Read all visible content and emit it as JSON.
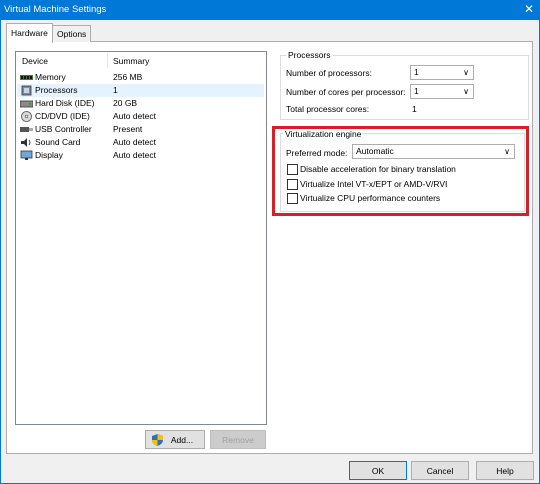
{
  "window": {
    "title": "Virtual Machine Settings",
    "close_glyph": "✕"
  },
  "tabs": [
    {
      "label": "Hardware"
    },
    {
      "label": "Options"
    }
  ],
  "device_list": {
    "col_device": "Device",
    "col_summary": "Summary",
    "rows": [
      {
        "device": "Memory",
        "summary": "256 MB",
        "icon": "memory-icon"
      },
      {
        "device": "Processors",
        "summary": "1",
        "icon": "processor-icon"
      },
      {
        "device": "Hard Disk (IDE)",
        "summary": "20 GB",
        "icon": "hard-disk-icon"
      },
      {
        "device": "CD/DVD (IDE)",
        "summary": "Auto detect",
        "icon": "cd-dvd-icon"
      },
      {
        "device": "USB Controller",
        "summary": "Present",
        "icon": "usb-icon"
      },
      {
        "device": "Sound Card",
        "summary": "Auto detect",
        "icon": "sound-card-icon"
      },
      {
        "device": "Display",
        "summary": "Auto detect",
        "icon": "display-icon"
      }
    ],
    "selected": "Processors"
  },
  "list_buttons": {
    "add": "Add...",
    "remove": "Remove"
  },
  "processors": {
    "legend": "Processors",
    "num_processors_label": "Number of processors:",
    "num_processors_value": "1",
    "cores_label": "Number of cores per processor:",
    "cores_value": "1",
    "total_label": "Total processor cores:",
    "total_value": "1"
  },
  "virtualization": {
    "legend": "Virtualization engine",
    "mode_label": "Preferred mode:",
    "mode_value": "Automatic",
    "options": [
      {
        "label": "Disable acceleration for binary translation",
        "checked": false
      },
      {
        "label": "Virtualize Intel VT-x/EPT or AMD-V/RVI",
        "checked": false
      },
      {
        "label": "Virtualize CPU performance counters",
        "checked": false
      }
    ]
  },
  "footer": {
    "ok": "OK",
    "cancel": "Cancel",
    "help": "Help"
  },
  "colors": {
    "titlebar": "#0078d7",
    "highlight": "#d62027"
  }
}
